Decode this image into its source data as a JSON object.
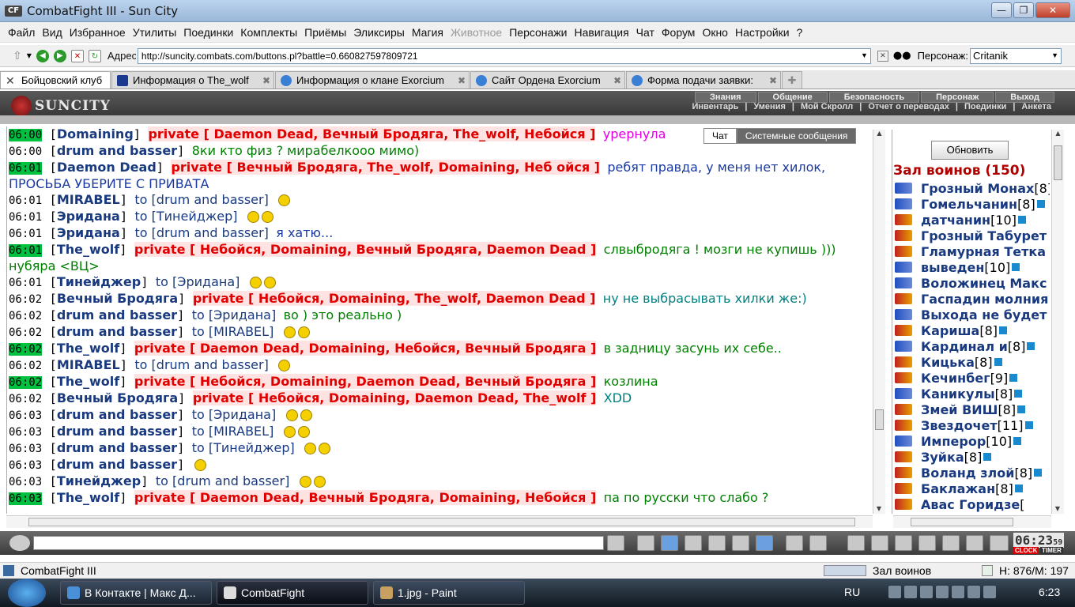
{
  "window": {
    "title": "CombatFight III - Sun City",
    "icon_text": "CF"
  },
  "menu": [
    "Файл",
    "Вид",
    "Избранное",
    "Утилиты",
    "Поединки",
    "Комплекты",
    "Приёмы",
    "Эликсиры",
    "Магия",
    "Животное",
    "Персонажи",
    "Навигация",
    "Чат",
    "Форум",
    "Окно",
    "Настройки",
    "?"
  ],
  "address": {
    "label": "Адрес",
    "url": "http://suncity.combats.com/buttons.pl?battle=0.660827597809721",
    "character_label": "Персонаж:",
    "character": "Critanik"
  },
  "tabs": [
    {
      "label": "Бойцовский клуб"
    },
    {
      "label": "Информация о The_wolf"
    },
    {
      "label": "Информация о клане Exorcium"
    },
    {
      "label": "Сайт Ордена Exorcium"
    },
    {
      "label": "Форма подачи заявки:"
    }
  ],
  "header": {
    "logo": "SUNCITY",
    "nav1": [
      "Знания",
      "Общение",
      "Безопасность",
      "Персонаж",
      "Выход"
    ],
    "nav2": [
      "Инвентарь",
      "Умения",
      "Мой Скролл",
      "Отчет о переводах",
      "Поединки",
      "Анкета"
    ],
    "nav_sep": "|"
  },
  "chat_tabs": [
    "Чат",
    "Системные сообщения"
  ],
  "chat": [
    {
      "t": "06:00",
      "hl": true,
      "nick": "Domaining",
      "priv": "private [ Daemon Dead, Вечный Бродяга, The_wolf, Небойся ]",
      "msg": "урернула",
      "color": "#e000e0"
    },
    {
      "t": "06:00",
      "hl": false,
      "nick": "drum and basser",
      "msg": "8ки кто физ ? мирабелкооо мимо)",
      "color": "#008000"
    },
    {
      "t": "06:01",
      "hl": true,
      "nick": "Daemon Dead",
      "priv": "private [ Вечный Бродяга, The_wolf, Domaining, Неб ойся ]",
      "msg": "ребят правда, у меня нет хилок, ПРОСЬБА УБЕРИТЕ С ПРИВАТА",
      "color": "#1a3aa0",
      "wrap": true
    },
    {
      "t": "06:01",
      "hl": false,
      "nick": "MIRABEL",
      "to": "to [drum and basser]",
      "smiles": 1,
      "color": "#000"
    },
    {
      "t": "06:01",
      "hl": false,
      "nick": "Эридана",
      "to": "to [Тинейджер]",
      "smiles": 2,
      "color": "#1a3aa0"
    },
    {
      "t": "06:01",
      "hl": false,
      "nick": "Эридана",
      "to": "to [drum and basser]",
      "msg": "я хатю...",
      "color": "#1a3aa0"
    },
    {
      "t": "06:01",
      "hl": true,
      "nick": "The_wolf",
      "priv": "private [ Небойся, Domaining, Вечный Бродяга, Daemon Dead ]",
      "msg": "слвыбродяга ! мозги не купишь ))) нубяра <ВЦ>",
      "color": "#008000",
      "wrap": true
    },
    {
      "t": "06:01",
      "hl": false,
      "nick": "Тинейджер",
      "to": "to [Эридана]",
      "smiles": 2,
      "color": "#1a3aa0"
    },
    {
      "t": "06:02",
      "hl": false,
      "nick": "Вечный Бродяга",
      "priv": "private [ Небойся, Domaining, The_wolf, Daemon Dead ]",
      "msg": "ну не выбрасывать хилки же:)",
      "color": "#008080"
    },
    {
      "t": "06:02",
      "hl": false,
      "nick": "drum and basser",
      "to": "to [Эридана]",
      "msg": "во ) это реально )",
      "color": "#008000"
    },
    {
      "t": "06:02",
      "hl": false,
      "nick": "drum and basser",
      "to": "to [MIRABEL]",
      "smiles": 2,
      "color": "#008000"
    },
    {
      "t": "06:02",
      "hl": true,
      "nick": "The_wolf",
      "priv": "private [ Daemon Dead, Domaining, Небойся, Вечный Бродяга ]",
      "msg": "в задницу засунь их себе..",
      "color": "#008000"
    },
    {
      "t": "06:02",
      "hl": false,
      "nick": "MIRABEL",
      "to": "to [drum and basser]",
      "smiles": 1,
      "color": "#000"
    },
    {
      "t": "06:02",
      "hl": true,
      "nick": "The_wolf",
      "priv": "private [ Небойся, Domaining, Daemon Dead, Вечный Бродяга ]",
      "msg": "козлина",
      "color": "#008000"
    },
    {
      "t": "06:02",
      "hl": false,
      "nick": "Вечный Бродяга",
      "priv": "private [ Небойся, Domaining, Daemon Dead, The_wolf ]",
      "msg": "XDD",
      "color": "#008080"
    },
    {
      "t": "06:03",
      "hl": false,
      "nick": "drum and basser",
      "to": "to [Эридана]",
      "smiles": 2,
      "color": "#008000"
    },
    {
      "t": "06:03",
      "hl": false,
      "nick": "drum and basser",
      "to": "to [MIRABEL]",
      "smiles": 2,
      "color": "#008000"
    },
    {
      "t": "06:03",
      "hl": false,
      "nick": "drum and basser",
      "to": "to [Тинейджер]",
      "smiles": 2,
      "color": "#008000"
    },
    {
      "t": "06:03",
      "hl": false,
      "nick": "drum and basser",
      "smiles": 1,
      "color": "#008000"
    },
    {
      "t": "06:03",
      "hl": false,
      "nick": "Тинейджер",
      "to": "to [drum and basser]",
      "smiles": 2,
      "color": "#1a3aa0"
    },
    {
      "t": "06:03",
      "hl": true,
      "nick": "The_wolf",
      "priv": "private [ Daemon Dead, Вечный Бродяга, Domaining, Небойся ]",
      "msg": "па по русски что слабо ?",
      "color": "#008000"
    }
  ],
  "sidebar": {
    "refresh_label": "Обновить",
    "room_title": "Зал воинов (150)",
    "users": [
      {
        "name": "Грозный Монах",
        "lvl": "[8]",
        "red": false
      },
      {
        "name": "Гомельчанин",
        "lvl": "[8]",
        "red": false
      },
      {
        "name": "датчанин",
        "lvl": "[10]",
        "red": true
      },
      {
        "name": "Грозный Табурет",
        "lvl": "",
        "red": true
      },
      {
        "name": "Гламурная Тетка",
        "lvl": "",
        "red": true
      },
      {
        "name": "выведен",
        "lvl": "[10]",
        "red": false
      },
      {
        "name": "Воложинец Макс",
        "lvl": "",
        "red": false
      },
      {
        "name": "Гаспадин молния",
        "lvl": "",
        "red": true
      },
      {
        "name": "Выхода не будет",
        "lvl": "",
        "red": false
      },
      {
        "name": "Кариша",
        "lvl": "[8]",
        "red": true
      },
      {
        "name": "Кардинал и",
        "lvl": "[8]",
        "red": false
      },
      {
        "name": "Кицька",
        "lvl": "[8]",
        "red": true
      },
      {
        "name": "Кечинбег",
        "lvl": "[9]",
        "red": true
      },
      {
        "name": "Каникулы",
        "lvl": "[8]",
        "red": false
      },
      {
        "name": "Змей ВИШ",
        "lvl": "[8]",
        "red": true
      },
      {
        "name": "Звездочет",
        "lvl": "[11]",
        "red": true
      },
      {
        "name": "Имперор",
        "lvl": "[10]",
        "red": false
      },
      {
        "name": "Зуйка",
        "lvl": "[8]",
        "red": true
      },
      {
        "name": "Воланд злой",
        "lvl": "[8]",
        "red": true
      },
      {
        "name": "Баклажан",
        "lvl": "[8]",
        "red": true
      },
      {
        "name": "Авас Горидзе",
        "lvl": "[",
        "red": true
      }
    ]
  },
  "clock": {
    "time": "06:23",
    "sec": "59",
    "clock_label": "CLOCK",
    "timer_label": "TIMER"
  },
  "statusbar": {
    "left": "CombatFight III",
    "room": "Зал воинов",
    "hp": "H: 876/M: 197"
  },
  "taskbar": {
    "tasks": [
      "В Контакте | Макс Д...",
      "CombatFight",
      "1.jpg - Paint"
    ],
    "lang": "RU",
    "time": "6:23"
  }
}
